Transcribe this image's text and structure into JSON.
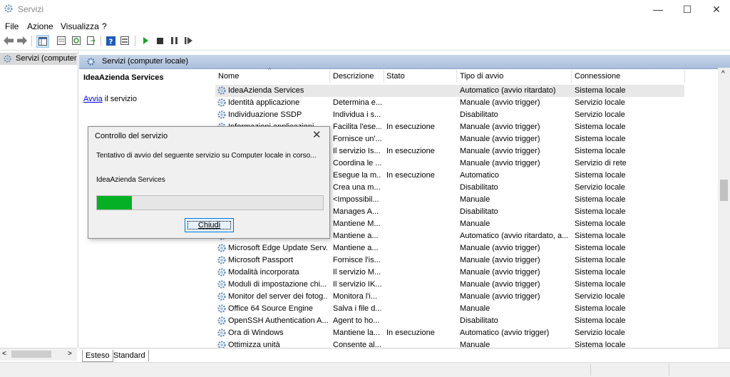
{
  "window": {
    "title": "Servizi",
    "controls": {
      "minimize": "—",
      "maximize": "☐",
      "close": "✕"
    }
  },
  "menu": [
    "File",
    "Azione",
    "Visualizza",
    "?"
  ],
  "toolbar_icons": [
    "back-icon",
    "forward-icon",
    "console-tree-icon",
    "properties-icon",
    "refresh-icon",
    "export-icon",
    "help-icon",
    "view-icon",
    "start-service-icon",
    "stop-service-icon",
    "pause-service-icon",
    "restart-service-icon"
  ],
  "tree": {
    "node_label": "Servizi (computer"
  },
  "pane_header": "Servizi (computer locale)",
  "extended": {
    "service_name": "IdeaAzienda Services",
    "action_link": "Avvia",
    "action_rest": " il servizio"
  },
  "columns": {
    "name": "Nome",
    "desc": "Descrizione",
    "stato": "Stato",
    "tipo": "Tipo di avvio",
    "conn": "Connessione"
  },
  "rows": [
    {
      "name": "IdeaAzienda Services",
      "desc": "",
      "stato": "",
      "tipo": "Automatico (avvio ritardato)",
      "conn": "Sistema locale",
      "sel": true
    },
    {
      "name": "Identità applicazione",
      "desc": "Determina e...",
      "stato": "",
      "tipo": "Manuale (avvio trigger)",
      "conn": "Servizio locale"
    },
    {
      "name": "Individuazione SSDP",
      "desc": "Individua i s...",
      "stato": "",
      "tipo": "Disabilitato",
      "conn": "Servizio locale"
    },
    {
      "name": "Informazioni applicazioni",
      "desc": "Facilita l'ese...",
      "stato": "In esecuzione",
      "tipo": "Manuale (avvio trigger)",
      "conn": "Sistema locale"
    },
    {
      "name": "",
      "desc": "Fornisce un'...",
      "stato": "",
      "tipo": "Manuale (avvio trigger)",
      "conn": "Sistema locale"
    },
    {
      "name": "",
      "desc": "Il servizio Is...",
      "stato": "In esecuzione",
      "tipo": "Manuale (avvio trigger)",
      "conn": "Sistema locale"
    },
    {
      "name": "",
      "desc": "Coordina le ...",
      "stato": "",
      "tipo": "Manuale (avvio trigger)",
      "conn": "Servizio di rete"
    },
    {
      "name": "",
      "desc": "Esegue la m...",
      "stato": "In esecuzione",
      "tipo": "Automatico",
      "conn": "Sistema locale"
    },
    {
      "name": "",
      "desc": "Crea una m...",
      "stato": "",
      "tipo": "Disabilitato",
      "conn": "Servizio locale"
    },
    {
      "name": "",
      "desc": "<Impossibil...",
      "stato": "",
      "tipo": "Manuale",
      "conn": "Sistema locale"
    },
    {
      "name": "",
      "desc": "Manages A...",
      "stato": "",
      "tipo": "Disabilitato",
      "conn": "Sistema locale"
    },
    {
      "name": "",
      "desc": "Mantiene M...",
      "stato": "",
      "tipo": "Manuale",
      "conn": "Sistema locale"
    },
    {
      "name": "",
      "desc": "Mantiene a...",
      "stato": "",
      "tipo": "Automatico (avvio ritardato, a...",
      "conn": "Sistema locale"
    },
    {
      "name": "Microsoft Edge Update Serv...",
      "desc": "Mantiene a...",
      "stato": "",
      "tipo": "Manuale (avvio trigger)",
      "conn": "Sistema locale"
    },
    {
      "name": "Microsoft Passport",
      "desc": "Fornisce l'is...",
      "stato": "",
      "tipo": "Manuale (avvio trigger)",
      "conn": "Sistema locale"
    },
    {
      "name": "Modalità incorporata",
      "desc": "Il servizio M...",
      "stato": "",
      "tipo": "Manuale (avvio trigger)",
      "conn": "Sistema locale"
    },
    {
      "name": "Moduli di impostazione chi...",
      "desc": "Il servizio IK...",
      "stato": "",
      "tipo": "Manuale (avvio trigger)",
      "conn": "Sistema locale"
    },
    {
      "name": "Monitor del server dei fotog...",
      "desc": "Monitora l'i...",
      "stato": "",
      "tipo": "Manuale (avvio trigger)",
      "conn": "Servizio locale"
    },
    {
      "name": "Office 64 Source Engine",
      "desc": "Salva i file d...",
      "stato": "",
      "tipo": "Manuale",
      "conn": "Sistema locale"
    },
    {
      "name": "OpenSSH Authentication A...",
      "desc": "Agent to ho...",
      "stato": "",
      "tipo": "Disabilitato",
      "conn": "Sistema locale"
    },
    {
      "name": "Ora di Windows",
      "desc": "Mantiene la...",
      "stato": "In esecuzione",
      "tipo": "Automatico (avvio trigger)",
      "conn": "Servizio locale"
    },
    {
      "name": "Ottimizza unità",
      "desc": "Consente al...",
      "stato": "",
      "tipo": "Manuale",
      "conn": "Sistema locale"
    }
  ],
  "tabs": [
    "Esteso",
    "Standard"
  ],
  "dialog": {
    "title": "Controllo del servizio",
    "close": "✕",
    "message": "Tentativo di avvio del seguente servizio su Computer locale in corso...",
    "service": "IdeaAzienda Services",
    "progress": 0.155,
    "progress_color": "#06b025",
    "button": "Chiudi"
  },
  "colors": {
    "selection": "#e8e8e8",
    "pane_header": "#b9cae3",
    "link": "#0000ee"
  }
}
